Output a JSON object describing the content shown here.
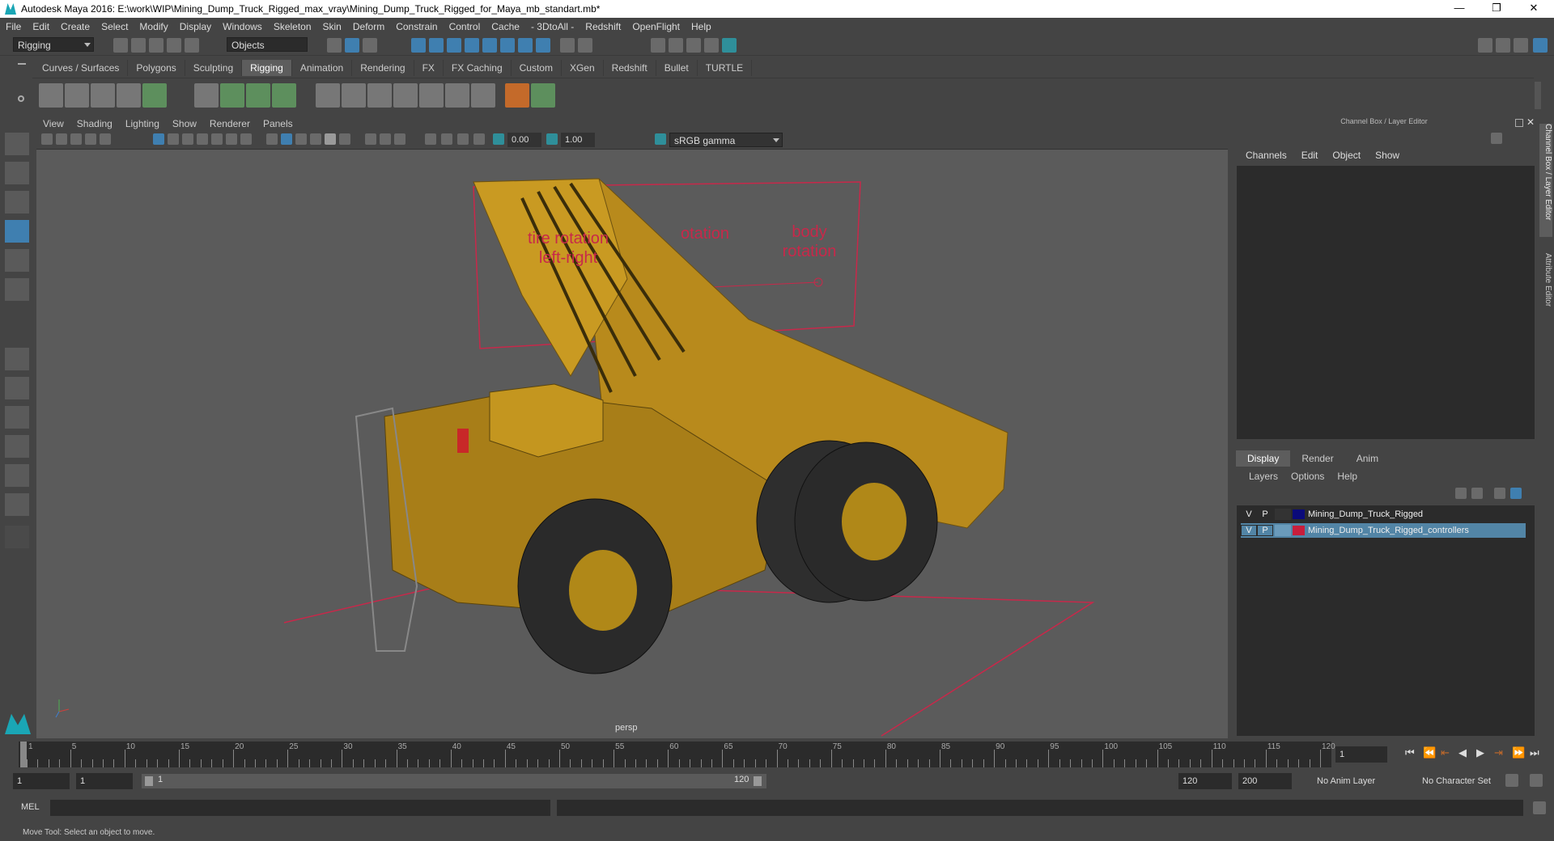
{
  "window": {
    "title": "Autodesk Maya 2016: E:\\work\\WIP\\Mining_Dump_Truck_Rigged_max_vray\\Mining_Dump_Truck_Rigged_for_Maya_mb_standart.mb*",
    "minimize": "—",
    "restore": "❐",
    "close": "✕"
  },
  "menubar": [
    "File",
    "Edit",
    "Create",
    "Select",
    "Modify",
    "Display",
    "Windows",
    "Skeleton",
    "Skin",
    "Deform",
    "Constrain",
    "Control",
    "Cache",
    "- 3DtoAll -",
    "Redshift",
    "OpenFlight",
    "Help"
  ],
  "statusline": {
    "menuset": "Rigging",
    "selection_mode": "Objects"
  },
  "shelf": {
    "tabs": [
      "Curves / Surfaces",
      "Polygons",
      "Sculpting",
      "Rigging",
      "Animation",
      "Rendering",
      "FX",
      "FX Caching",
      "Custom",
      "XGen",
      "Redshift",
      "Bullet",
      "TURTLE"
    ],
    "active_tab": "Rigging"
  },
  "viewport": {
    "menu": [
      "View",
      "Shading",
      "Lighting",
      "Show",
      "Renderer",
      "Panels"
    ],
    "exposure": "0.00",
    "gamma": "1.00",
    "colorspace": "sRGB gamma",
    "camera_label": "persp",
    "overlay_labels": {
      "tire_rotation": "tire rotation\nleft-right",
      "middle_rotation": "otation",
      "body_rotation": "body\nrotation"
    }
  },
  "channel_box": {
    "header": "Channel Box / Layer Editor",
    "menu": [
      "Channels",
      "Edit",
      "Object",
      "Show"
    ]
  },
  "layer_editor": {
    "tabs": [
      "Display",
      "Render",
      "Anim"
    ],
    "active_tab": "Display",
    "menu": [
      "Layers",
      "Options",
      "Help"
    ],
    "layers": [
      {
        "v": "V",
        "p": "P",
        "color": "#0a0a7a",
        "name": "Mining_Dump_Truck_Rigged",
        "selected": false
      },
      {
        "v": "V",
        "p": "P",
        "color": "#c81e3c",
        "name": "Mining_Dump_Truck_Rigged_controllers",
        "selected": true
      }
    ]
  },
  "side_tabs": [
    "Channel Box / Layer Editor",
    "Attribute Editor"
  ],
  "time_slider": {
    "ticks": [
      "1",
      "5",
      "10",
      "15",
      "20",
      "25",
      "30",
      "35",
      "40",
      "45",
      "50",
      "55",
      "60",
      "65",
      "70",
      "75",
      "80",
      "85",
      "90",
      "95",
      "100",
      "105",
      "110",
      "115",
      "120"
    ],
    "current_frame": "1"
  },
  "range_slider": {
    "start": "1",
    "playback_start": "1",
    "range_start_label": "1",
    "range_end_label": "120",
    "playback_end": "120",
    "end": "200",
    "anim_layer": "No Anim Layer",
    "character_set": "No Character Set"
  },
  "command_line": {
    "label": "MEL"
  },
  "help_line": "Move Tool: Select an object to move."
}
